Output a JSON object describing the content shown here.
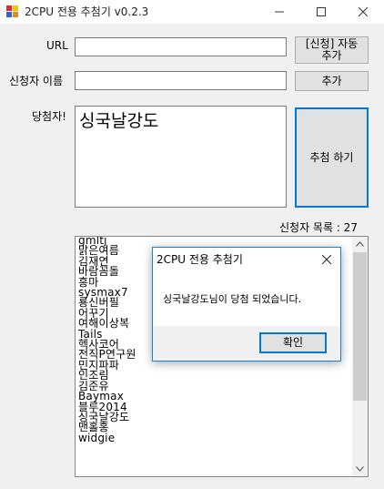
{
  "window": {
    "title": "2CPU 전용 추첨기 v0.2.3"
  },
  "form": {
    "url_label": "URL",
    "url_value": "",
    "apply_button_line1": "[신청] 자동",
    "apply_button_line2": "추가",
    "applicant_label": "신청자 이름",
    "applicant_value": "",
    "add_button": "추가",
    "winner_label": "당첨자!",
    "winner_value": "싱국날강도",
    "draw_button": "추첨 하기",
    "count_label": "신청자 목록 : 27"
  },
  "applicants": [
    "gmltj",
    "맑은여름",
    "김재연",
    "바람꼼돌",
    "흥마",
    "sysmax7",
    "룡신버필",
    "어꾸기",
    "여해이상복",
    "Tails",
    "헥사코어",
    "전직P연구원",
    "민지파파",
    "인조림",
    "김준유",
    "Baymax",
    "블루2014",
    "싱국날강도",
    "맨홀홍",
    "widgie"
  ],
  "dialog": {
    "title": "2CPU 전용 추첨기",
    "message": "싱국날강도님이 당첨 되었습니다.",
    "ok_button": "확인"
  }
}
